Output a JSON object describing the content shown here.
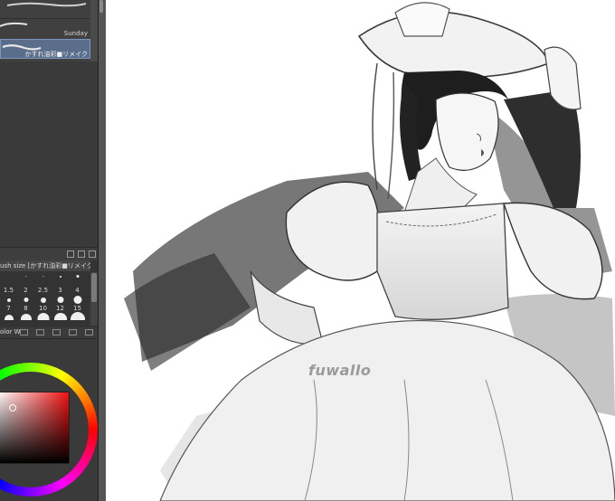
{
  "brush_list": {
    "items": [
      {
        "name": "Sunday"
      },
      {
        "name": "かすれ油彩■リメイク",
        "selected": true
      }
    ]
  },
  "brush_size": {
    "header": "ush size [かすれ油彩■リメイク]",
    "sizes": [
      "1.5",
      "2",
      "2.5",
      "3",
      "4",
      "7",
      "8",
      "10",
      "12",
      "15"
    ]
  },
  "color_panel": {
    "tab_label": "olor W",
    "selected_color": "#dcdcdc",
    "hue": "#ee1111"
  },
  "canvas": {
    "watermark": "fuwallo"
  }
}
